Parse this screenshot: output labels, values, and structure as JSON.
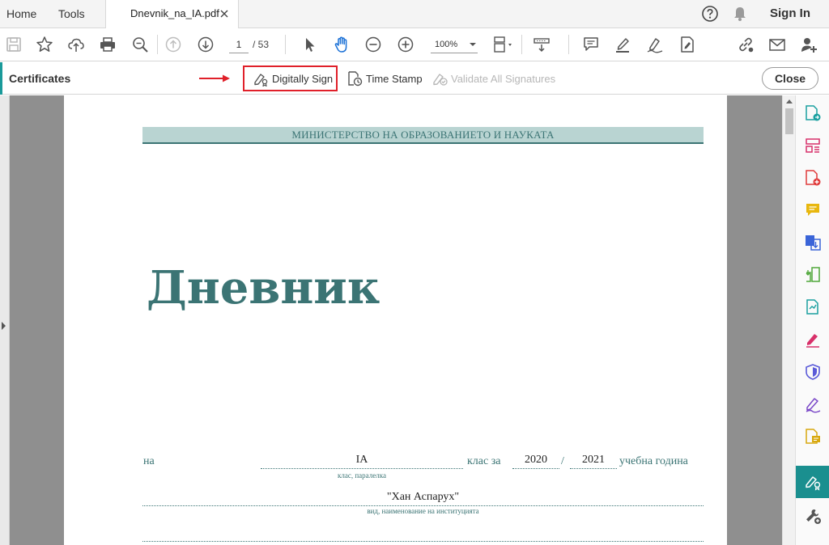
{
  "tabs": {
    "home": "Home",
    "tools": "Tools",
    "document": "Dnevnik_na_IA.pdf",
    "sign_in": "Sign In"
  },
  "toolbar": {
    "page_current": "1",
    "page_total": "/ 53",
    "zoom": "100%"
  },
  "certificates": {
    "title": "Certificates",
    "digitally_sign": "Digitally Sign",
    "time_stamp": "Time Stamp",
    "validate_all": "Validate All Signatures",
    "close": "Close"
  },
  "document": {
    "ministry": "МИНИСТЕРСТВО НА ОБРАЗОВАНИЕТО И НАУКАТА",
    "title": "Дневник",
    "na": "на",
    "class_value": "IA",
    "class_caption": "клас, паралелка",
    "klas_za": "клас за",
    "year_from": "2020",
    "slash": "/",
    "year_to": "2021",
    "uchebna": "учебна година",
    "institution": "\"Хан Аспарух\"",
    "institution_caption": "вид, наименование на институцията"
  },
  "colors": {
    "accent_teal": "#1a8f8f",
    "doc_teal": "#3b7474",
    "highlight_red": "#e0202a"
  }
}
